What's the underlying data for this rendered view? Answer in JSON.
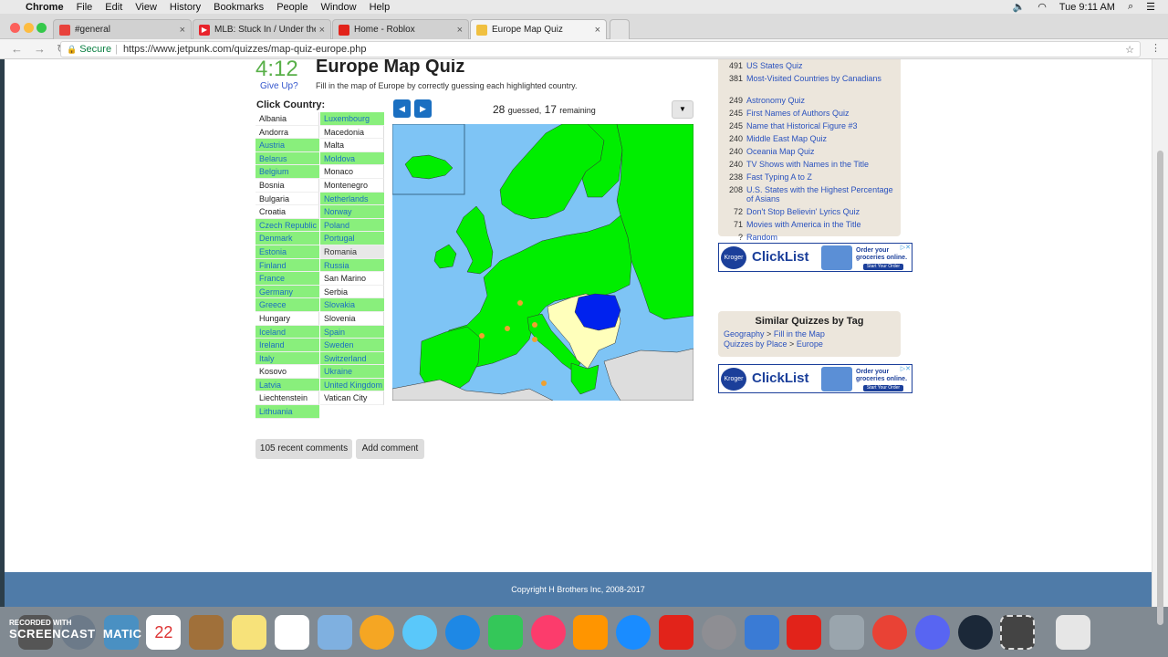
{
  "menubar": {
    "app": "Chrome",
    "items": [
      "File",
      "Edit",
      "View",
      "History",
      "Bookmarks",
      "People",
      "Window",
      "Help"
    ],
    "clock": "Tue 9:11 AM"
  },
  "tabs": [
    {
      "title": "#general",
      "icon_color": "#e8423b"
    },
    {
      "title": "MLB: Stuck In / Under the Wa",
      "icon_color": "#e8232b"
    },
    {
      "title": "Home - Roblox",
      "icon_color": "#e2231a"
    },
    {
      "title": "Europe Map Quiz",
      "icon_color": "#f0c040"
    }
  ],
  "address": {
    "secure": "Secure",
    "url": "https://www.jetpunk.com/quizzes/map-quiz-europe.php"
  },
  "quiz": {
    "timer": "4:12",
    "give_up": "Give Up?",
    "title": "Europe Map Quiz",
    "description": "Fill in the map of Europe by correctly guessing each highlighted country.",
    "click_label": "Click Country:",
    "guessed_count": "28",
    "guessed_word": "guessed,",
    "remaining_count": "17",
    "remaining_word": "remaining",
    "col1": [
      {
        "name": "Albania",
        "s": "w"
      },
      {
        "name": "Andorra",
        "s": "w"
      },
      {
        "name": "Austria",
        "s": "g"
      },
      {
        "name": "Belarus",
        "s": "g"
      },
      {
        "name": "Belgium",
        "s": "g"
      },
      {
        "name": "Bosnia",
        "s": "w"
      },
      {
        "name": "Bulgaria",
        "s": "w"
      },
      {
        "name": "Croatia",
        "s": "w"
      },
      {
        "name": "Czech Republic",
        "s": "g"
      },
      {
        "name": "Denmark",
        "s": "g"
      },
      {
        "name": "Estonia",
        "s": "g"
      },
      {
        "name": "Finland",
        "s": "g"
      },
      {
        "name": "France",
        "s": "g"
      },
      {
        "name": "Germany",
        "s": "g"
      },
      {
        "name": "Greece",
        "s": "g"
      },
      {
        "name": "Hungary",
        "s": "w"
      },
      {
        "name": "Iceland",
        "s": "g"
      },
      {
        "name": "Ireland",
        "s": "g"
      },
      {
        "name": "Italy",
        "s": "g"
      },
      {
        "name": "Kosovo",
        "s": "w"
      },
      {
        "name": "Latvia",
        "s": "g"
      },
      {
        "name": "Liechtenstein",
        "s": "w"
      },
      {
        "name": "Lithuania",
        "s": "g"
      }
    ],
    "col2": [
      {
        "name": "Luxembourg",
        "s": "g"
      },
      {
        "name": "Macedonia",
        "s": "w"
      },
      {
        "name": "Malta",
        "s": "w"
      },
      {
        "name": "Moldova",
        "s": "g"
      },
      {
        "name": "Monaco",
        "s": "w"
      },
      {
        "name": "Montenegro",
        "s": "w"
      },
      {
        "name": "Netherlands",
        "s": "g"
      },
      {
        "name": "Norway",
        "s": "g"
      },
      {
        "name": "Poland",
        "s": "g"
      },
      {
        "name": "Portugal",
        "s": "g"
      },
      {
        "name": "Romania",
        "s": "hov"
      },
      {
        "name": "Russia",
        "s": "g"
      },
      {
        "name": "San Marino",
        "s": "w"
      },
      {
        "name": "Serbia",
        "s": "w"
      },
      {
        "name": "Slovakia",
        "s": "g"
      },
      {
        "name": "Slovenia",
        "s": "w"
      },
      {
        "name": "Spain",
        "s": "g"
      },
      {
        "name": "Sweden",
        "s": "g"
      },
      {
        "name": "Switzerland",
        "s": "g"
      },
      {
        "name": "Ukraine",
        "s": "g"
      },
      {
        "name": "United Kingdom",
        "s": "g"
      },
      {
        "name": "Vatican City",
        "s": "w"
      }
    ]
  },
  "top_quizzes": [
    {
      "n": "491",
      "t": "US States Quiz"
    },
    {
      "n": "381",
      "t": "Most-Visited Countries by Canadians"
    },
    {
      "n": "249",
      "t": "Astronomy Quiz"
    },
    {
      "n": "245",
      "t": "First Names of Authors Quiz"
    },
    {
      "n": "245",
      "t": "Name that Historical Figure #3"
    },
    {
      "n": "240",
      "t": "Middle East Map Quiz"
    },
    {
      "n": "240",
      "t": "Oceania Map Quiz"
    },
    {
      "n": "240",
      "t": "TV Shows with Names in the Title"
    },
    {
      "n": "238",
      "t": "Fast Typing A to Z"
    },
    {
      "n": "208",
      "t": "U.S. States with the Highest Percentage of Asians"
    },
    {
      "n": "72",
      "t": "Don't Stop Believin' Lyrics Quiz"
    },
    {
      "n": "71",
      "t": "Movies with America in the Title"
    },
    {
      "n": "?",
      "t": "Random"
    }
  ],
  "ad": {
    "logo": "Kroger",
    "brand": "ClickList",
    "headline": "Order your groceries online.",
    "cta": "Start Your Order"
  },
  "similar": {
    "heading": "Similar Quizzes by Tag",
    "row1_a": "Geography",
    "row1_sep": ">",
    "row1_b": "Fill in the Map",
    "row2_a": "Quizzes by Place",
    "row2_sep": ">",
    "row2_b": "Europe"
  },
  "comments_button": "105 recent comments",
  "add_comment_button": "Add comment",
  "footer": "Copyright H Brothers Inc, 2008-2017",
  "watermark": {
    "line1": "RECORDED WITH",
    "line2": "SCREENCAST",
    "line3": "MATIC"
  },
  "colors": {
    "guessed": "#89ef7c",
    "highlight": "#0022ee",
    "pending": "#ffffbb",
    "sea": "#7ec4f5",
    "footer": "#4f7ba8"
  }
}
